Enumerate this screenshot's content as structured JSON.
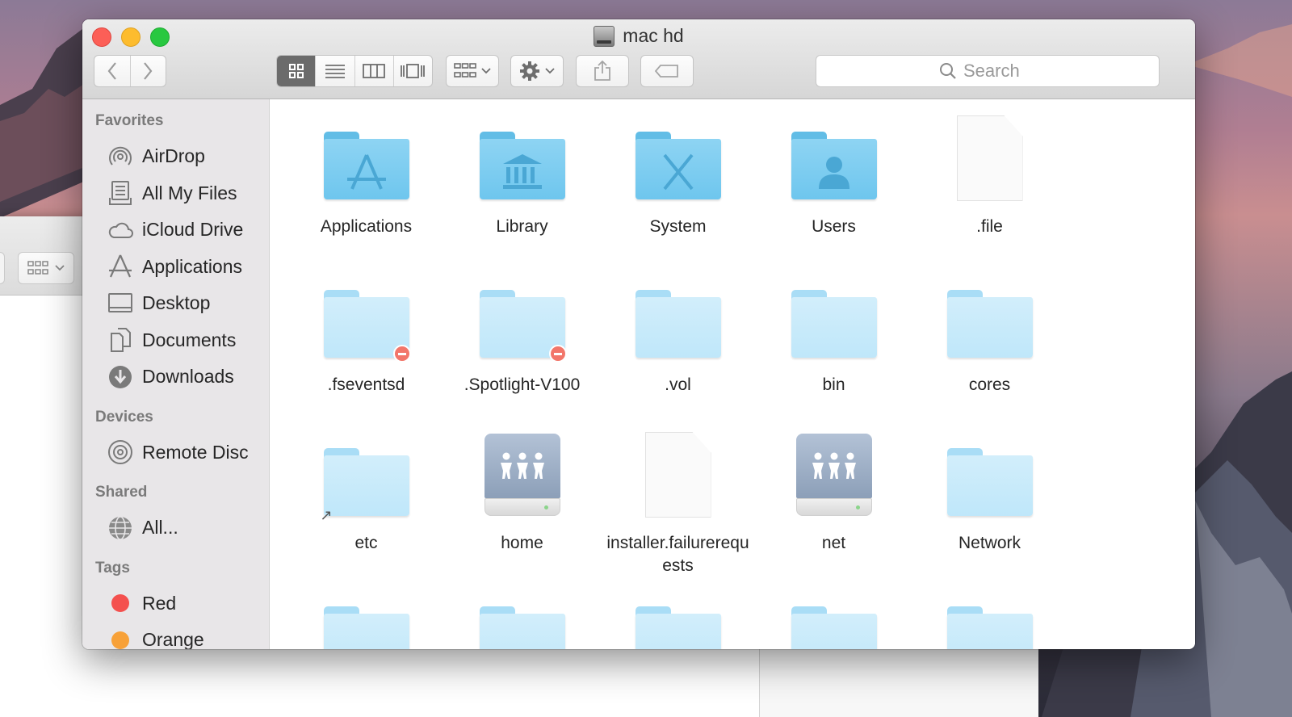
{
  "window": {
    "title": "mac hd"
  },
  "toolbar": {
    "back_icon": "chevron-left-icon",
    "forward_icon": "chevron-right-icon",
    "view_modes": [
      "icon-view",
      "list-view",
      "column-view",
      "cover-flow-view"
    ],
    "active_view": "icon-view",
    "search_placeholder": "Search"
  },
  "sidebar": {
    "favorites_label": "Favorites",
    "favorites": [
      {
        "label": "AirDrop",
        "icon": "airdrop-icon"
      },
      {
        "label": "All My Files",
        "icon": "all-my-files-icon"
      },
      {
        "label": "iCloud Drive",
        "icon": "cloud-icon"
      },
      {
        "label": "Applications",
        "icon": "applications-icon"
      },
      {
        "label": "Desktop",
        "icon": "desktop-icon"
      },
      {
        "label": "Documents",
        "icon": "documents-icon"
      },
      {
        "label": "Downloads",
        "icon": "downloads-icon"
      }
    ],
    "devices_label": "Devices",
    "devices": [
      {
        "label": "Remote Disc",
        "icon": "disc-icon"
      }
    ],
    "shared_label": "Shared",
    "shared": [
      {
        "label": "All...",
        "icon": "network-globe-icon"
      }
    ],
    "tags_label": "Tags",
    "tags": [
      {
        "label": "Red",
        "color": "#f4504e"
      },
      {
        "label": "Orange",
        "color": "#f7a138"
      }
    ]
  },
  "files": [
    {
      "name": "Applications",
      "kind": "folder-apps"
    },
    {
      "name": "Library",
      "kind": "folder-library"
    },
    {
      "name": "System",
      "kind": "folder-system"
    },
    {
      "name": "Users",
      "kind": "folder-users"
    },
    {
      "name": ".file",
      "kind": "document"
    },
    {
      "name": ".fseventsd",
      "kind": "folder-restricted"
    },
    {
      "name": ".Spotlight-V100",
      "kind": "folder-restricted"
    },
    {
      "name": ".vol",
      "kind": "folder-hidden"
    },
    {
      "name": "bin",
      "kind": "folder-hidden"
    },
    {
      "name": "cores",
      "kind": "folder-hidden"
    },
    {
      "name": "etc",
      "kind": "folder-alias"
    },
    {
      "name": "home",
      "kind": "server"
    },
    {
      "name": "installer.failurerequests",
      "kind": "document"
    },
    {
      "name": "net",
      "kind": "server"
    },
    {
      "name": "Network",
      "kind": "folder-hidden"
    },
    {
      "name": "",
      "kind": "folder-hidden"
    },
    {
      "name": "",
      "kind": "folder-hidden"
    },
    {
      "name": "",
      "kind": "folder-hidden"
    },
    {
      "name": "",
      "kind": "folder-hidden"
    },
    {
      "name": "",
      "kind": "folder-hidden"
    }
  ]
}
